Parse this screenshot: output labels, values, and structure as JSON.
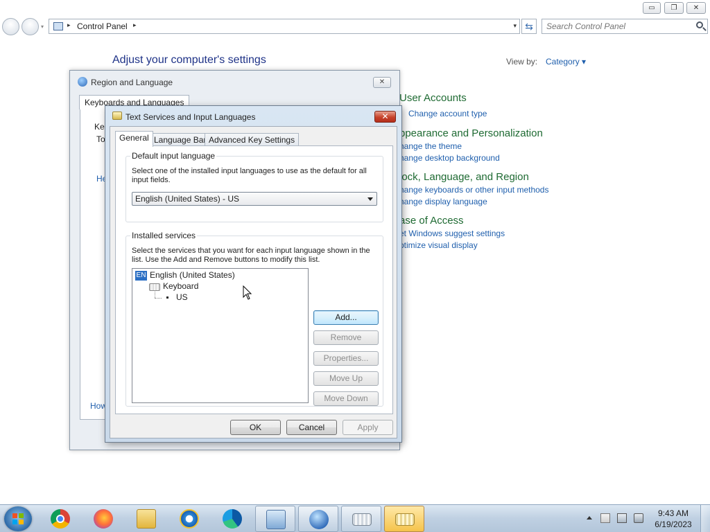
{
  "explorer": {
    "window_buttons": {
      "minimize": "▭",
      "maximize": "❐",
      "close": "✕"
    },
    "address": {
      "breadcrumb": "Control Panel",
      "separator": "▸",
      "dropdown": "▾"
    },
    "search": {
      "placeholder": "Search Control Panel"
    },
    "refresh_glyph": "⇆",
    "heading": "Adjust your computer's settings",
    "view_by_label": "View by:",
    "view_by_value": "Category ▾",
    "categories": [
      {
        "title": "User Accounts",
        "links": [
          "Change account type"
        ]
      },
      {
        "title": "ppearance and Personalization",
        "links": [
          "hange the theme",
          "hange desktop background"
        ]
      },
      {
        "title": "lock, Language, and Region",
        "links": [
          "hange keyboards or other input methods",
          "hange display language"
        ]
      },
      {
        "title": "ase of Access",
        "links": [
          "et Windows suggest settings",
          "ptimize visual display"
        ]
      }
    ]
  },
  "region_dialog": {
    "title": "Region and Language",
    "close": "✕",
    "tab": "Keyboards and Languages",
    "fragments": {
      "ke": "Ke",
      "to": "To",
      "he": "He",
      "how": "How"
    }
  },
  "text_services": {
    "title": "Text Services and Input Languages",
    "close": "✕",
    "tabs": [
      "General",
      "Language Bar",
      "Advanced Key Settings"
    ],
    "default_group": {
      "label": "Default input language",
      "description": "Select one of the installed input languages to use as the default for all input fields.",
      "selected": "English (United States) - US"
    },
    "services_group": {
      "label": "Installed services",
      "description": "Select the services that you want for each input language shown in the list. Use the Add and Remove buttons to modify this list.",
      "tree": {
        "badge": "EN",
        "language": "English (United States)",
        "service": "Keyboard",
        "layout": "US"
      },
      "buttons": [
        "Add...",
        "Remove",
        "Properties...",
        "Move Up",
        "Move Down"
      ]
    },
    "dialog_buttons": {
      "ok": "OK",
      "cancel": "Cancel",
      "apply": "Apply"
    }
  },
  "taskbar": {
    "apps": [
      "chrome-icon",
      "firefox-icon",
      "file-explorer-icon",
      "internet-explorer-icon",
      "edge-icon",
      "control-panel-icon",
      "region-language-icon",
      "keyboard-icon",
      "text-services-icon"
    ],
    "clock": {
      "time": "9:43 AM",
      "date": "6/19/2023"
    }
  },
  "colors": {
    "link": "#1f5fad",
    "category": "#1e6a32",
    "heading": "#1e3287"
  }
}
